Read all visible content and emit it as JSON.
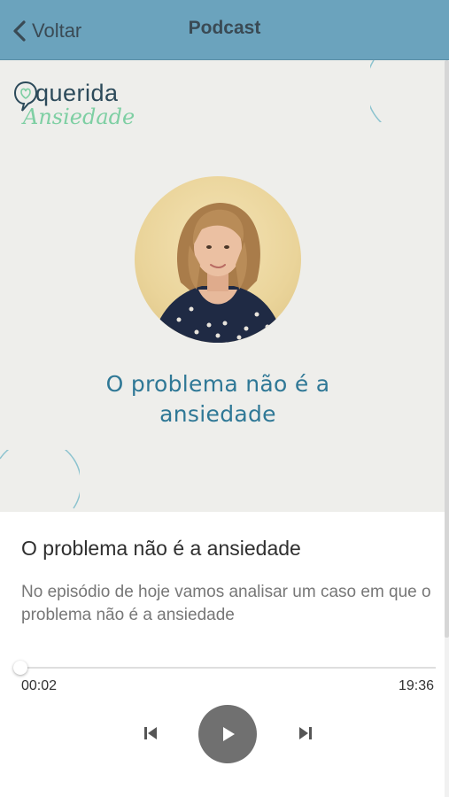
{
  "header": {
    "back_label": "Voltar",
    "title": "Podcast"
  },
  "cover": {
    "logo_line1": "querida",
    "logo_line2": "Ansiedade",
    "title_line1": "O problema não é a",
    "title_line2": "ansiedade"
  },
  "episode": {
    "title": "O problema não é a ansiedade",
    "description": "No episódio de hoje vamos analisar um caso em que o problema não é a ansiedade"
  },
  "player": {
    "current_time": "00:02",
    "total_time": "19:36",
    "progress_fraction": 0.002
  },
  "icons": {
    "back": "chevron-left-icon",
    "prev": "skip-previous-icon",
    "play": "play-icon",
    "next": "skip-next-icon"
  },
  "colors": {
    "header_bg": "#6ba3bd",
    "cover_title": "#2f7896",
    "play_button": "#707070"
  }
}
